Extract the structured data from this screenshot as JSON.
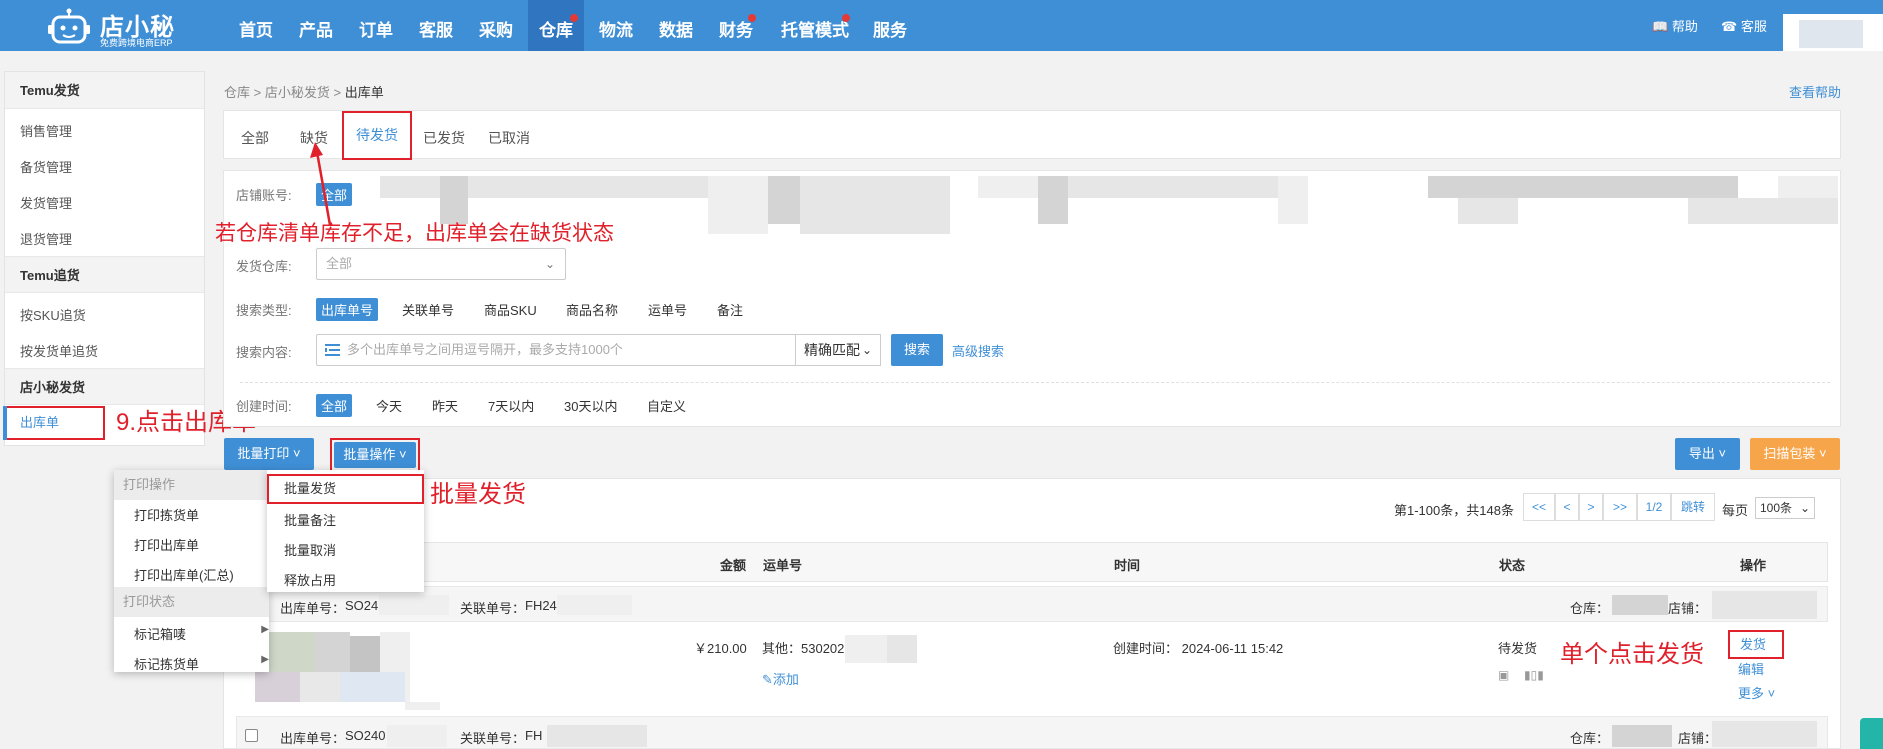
{
  "brand": {
    "name": "店小秘",
    "tagline": "免费跨境电商ERP"
  },
  "nav": {
    "items": [
      "首页",
      "产品",
      "订单",
      "客服",
      "采购",
      "仓库",
      "物流",
      "数据",
      "财务",
      "托管模式",
      "服务"
    ],
    "active": "仓库"
  },
  "topbar": {
    "help": "帮助",
    "service": "客服"
  },
  "sidebar": {
    "groups": [
      {
        "title": "Temu发货",
        "items": [
          "销售管理",
          "备货管理",
          "发货管理",
          "退货管理"
        ]
      },
      {
        "title": "Temu追货",
        "items": [
          "按SKU追货",
          "按发货单追货"
        ]
      },
      {
        "title": "店小秘发货",
        "items": [
          "出库单"
        ]
      }
    ]
  },
  "breadcrumb": {
    "items": [
      "仓库",
      "店小秘发货"
    ],
    "current": "出库单",
    "sep": ">"
  },
  "help_link": "查看帮助",
  "tabs": [
    "全部",
    "缺货",
    "待发货",
    "已发货",
    "已取消"
  ],
  "filters": {
    "store_label": "店铺账号:",
    "store_all": "全部",
    "warehouse_label": "发货仓库:",
    "warehouse_value": "全部",
    "search_type_label": "搜索类型:",
    "search_types": [
      "出库单号",
      "关联单号",
      "商品SKU",
      "商品名称",
      "运单号",
      "备注"
    ],
    "search_content_label": "搜索内容:",
    "search_placeholder": "多个出库单号之间用逗号隔开，最多支持1000个",
    "match": "精确匹配",
    "search_btn": "搜索",
    "advanced": "高级搜索",
    "created_label": "创建时间:",
    "created_opts": [
      "全部",
      "今天",
      "昨天",
      "7天以内",
      "30天以内",
      "自定义"
    ]
  },
  "annotations": {
    "stock": "若仓库清单库存不足，出库单会在缺货状态",
    "click_outbound": "9.点击出库单",
    "batch_ship": "批量发货",
    "single_ship": "单个点击发货"
  },
  "actions": {
    "batch_print": "批量打印",
    "batch_op": "批量操作",
    "export": "导出",
    "scan_pack": "扫描包装"
  },
  "print_menu": {
    "sec1": "打印操作",
    "items1": [
      "打印拣货单",
      "打印出库单",
      "打印出库单(汇总)"
    ],
    "sec2": "打印状态",
    "items2": [
      "标记箱唛",
      "标记拣货单"
    ]
  },
  "op_menu": [
    "批量发货",
    "批量备注",
    "批量取消",
    "释放占用"
  ],
  "pager": {
    "summary": "第1-100条，共148条",
    "first": "<<",
    "prev": "<",
    "next": ">",
    "last": ">>",
    "page": "1/2",
    "jump": "跳转",
    "per_label": "每页",
    "per_value": "100条"
  },
  "table": {
    "headers": [
      "金额",
      "运单号",
      "时间",
      "状态",
      "操作"
    ],
    "rows": [
      {
        "order_label": "出库单号：",
        "order_no": "SO24",
        "rel_label": "关联单号：",
        "rel_no": "FH24",
        "warehouse_label": "仓库：",
        "store_label": "店铺：",
        "amount": "￥210.00",
        "tracking": "其他：530202",
        "add": "添加",
        "created": "创建时间：  2024-06-11 15:42",
        "status": "待发货",
        "ops": [
          "发货",
          "编辑",
          "更多"
        ]
      },
      {
        "order_label": "出库单号：",
        "order_no": "SO240",
        "rel_label": "关联单号：",
        "rel_no": "FH",
        "warehouse_label": "仓库：",
        "store_label": "店铺："
      }
    ]
  },
  "colors": {
    "primary": "#3f8fd6",
    "nav_active": "#2f75bf",
    "highlight": "#e0202a",
    "orange": "#f7a54a"
  }
}
